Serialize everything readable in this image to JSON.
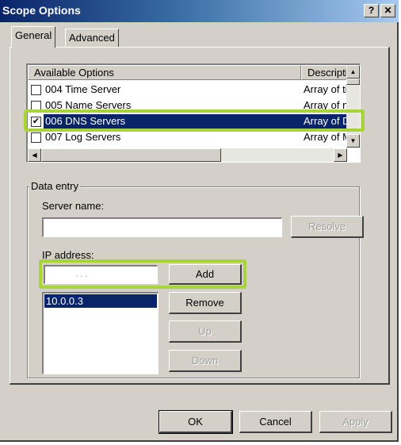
{
  "window": {
    "title": "Scope Options",
    "help_label": "?",
    "close_label": "✕"
  },
  "tabs": [
    {
      "label": "General",
      "active": true
    },
    {
      "label": "Advanced",
      "active": false
    }
  ],
  "options_list": {
    "columns": [
      "Available Options",
      "Description"
    ],
    "rows": [
      {
        "checked": false,
        "name": "004 Time Server",
        "description": "Array of time",
        "selected": false
      },
      {
        "checked": false,
        "name": "005 Name Servers",
        "description": "Array of nam",
        "selected": false
      },
      {
        "checked": true,
        "name": "006 DNS Servers",
        "description": "Array of DN",
        "selected": true
      },
      {
        "checked": false,
        "name": "007 Log Servers",
        "description": "Array of MIT",
        "selected": false
      }
    ],
    "scroll_up_icon": "▲",
    "scroll_down_icon": "▼",
    "scroll_left_icon": "◀",
    "scroll_right_icon": "▶",
    "check_mark": "✔"
  },
  "data_entry": {
    "group_label": "Data entry",
    "server_name_label": "Server name:",
    "server_name_value": "",
    "resolve_label": "Resolve",
    "ip_address_label": "IP address:",
    "ip_address_value": ".   .   .",
    "add_label": "Add",
    "ip_list": [
      "10.0.0.3"
    ],
    "remove_label": "Remove",
    "up_label": "Up",
    "down_label": "Down"
  },
  "footer": {
    "ok_label": "OK",
    "cancel_label": "Cancel",
    "apply_label": "Apply"
  },
  "colors": {
    "highlight": "#a8d43a",
    "selection": "#0a246a"
  }
}
